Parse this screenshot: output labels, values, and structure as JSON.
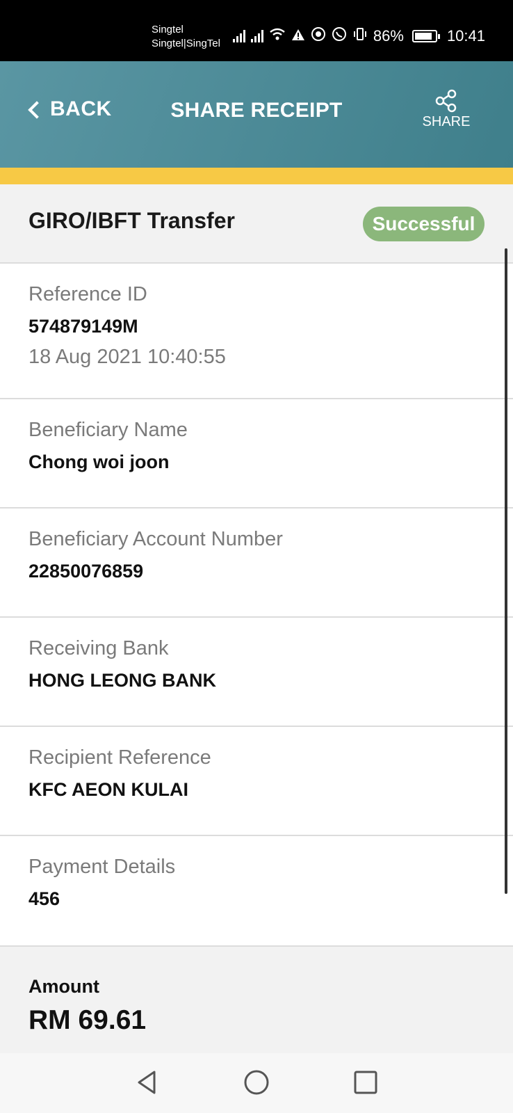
{
  "status_bar": {
    "carrier_line1": "Singtel",
    "carrier_line2": "Singtel|SingTel",
    "battery_percent": "86%",
    "battery_level": 0.86,
    "time": "10:41",
    "icons": [
      "signal-icon",
      "signal-icon",
      "wifi-icon",
      "warning-icon",
      "nfc-icon",
      "whatsapp-icon",
      "vibrate-icon",
      "battery-icon"
    ]
  },
  "header": {
    "back_label": "BACK",
    "title": "SHARE RECEIPT",
    "share_label": "SHARE"
  },
  "colors": {
    "header_start": "#5a96a3",
    "header_end": "#3f7f8b",
    "accent": "#f7c945",
    "success_badge": "#8bb77b"
  },
  "transaction": {
    "type": "GIRO/IBFT Transfer",
    "status": "Successful"
  },
  "fields": {
    "reference": {
      "label": "Reference ID",
      "value": "574879149M",
      "datetime": "18 Aug 2021 10:40:55"
    },
    "beneficiary_name": {
      "label": "Beneficiary Name",
      "value": "Chong woi joon"
    },
    "beneficiary_account": {
      "label": "Beneficiary Account Number",
      "value": "22850076859"
    },
    "receiving_bank": {
      "label": "Receiving Bank",
      "value": "HONG LEONG BANK"
    },
    "recipient_reference": {
      "label": "Recipient Reference",
      "value": "KFC AEON KULAI"
    },
    "payment_details": {
      "label": "Payment Details",
      "value": "456"
    }
  },
  "amount": {
    "label": "Amount",
    "value": "RM 69.61"
  },
  "nav": {
    "icons": [
      "back-triangle-icon",
      "home-circle-icon",
      "recents-square-icon"
    ]
  }
}
